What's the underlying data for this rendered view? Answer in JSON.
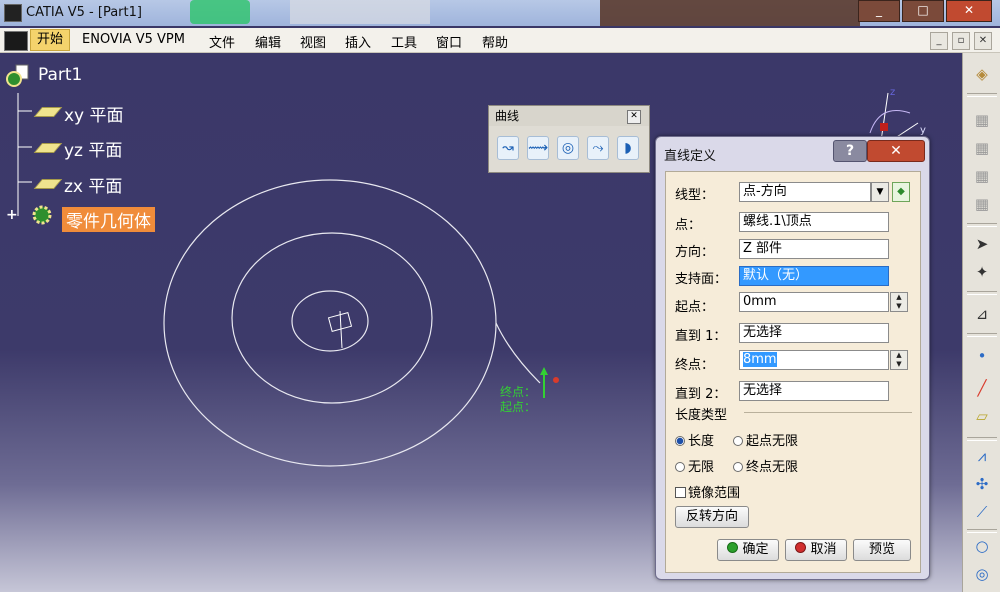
{
  "window": {
    "title": "CATIA V5 - [Part1]",
    "buttons": [
      "_",
      "□",
      "✕"
    ]
  },
  "menubar": {
    "items": [
      "开始",
      "ENOVIA V5 VPM",
      "文件",
      "编辑",
      "视图",
      "插入",
      "工具",
      "窗口",
      "帮助"
    ]
  },
  "tree": {
    "root": "Part1",
    "items": [
      "xy 平面",
      "yz 平面",
      "zx 平面"
    ],
    "body": "零件几何体"
  },
  "curve_toolbar": {
    "title": "曲线",
    "icons": [
      "spiral-curve-icon",
      "spline-icon",
      "helix-icon",
      "connect-curve-icon",
      "conic-icon"
    ]
  },
  "viewport": {
    "end_label": "终点：",
    "start_label": "起点："
  },
  "dialog": {
    "title": "直线定义",
    "help": "?",
    "close": "✕",
    "line_type_label": "线型：",
    "line_type_value": "点-方向",
    "point_label": "点：",
    "point_value": "螺线.1\\顶点",
    "direction_label": "方向：",
    "direction_value": "Z 部件",
    "support_label": "支持面：",
    "support_value": "默认（无）",
    "start_label": "起点：",
    "start_value": "0mm",
    "upto1_label": "直到 1：",
    "upto1_value": "无选择",
    "end_label": "终点：",
    "end_value": "8mm",
    "upto2_label": "直到 2：",
    "upto2_value": "无选择",
    "length_type_title": "长度类型",
    "radio_length": "长度",
    "radio_start_infinite": "起点无限",
    "radio_infinite": "无限",
    "radio_end_infinite": "终点无限",
    "selected_length_type": "长度",
    "mirror_label": "镜像范围",
    "reverse_button": "反转方向",
    "ok_button": "确定",
    "cancel_button": "取消",
    "preview_button": "预览"
  },
  "colors": {
    "viewport_bg": "#3b3869",
    "highlight": "#f08c3a",
    "selection": "#3399ff"
  }
}
